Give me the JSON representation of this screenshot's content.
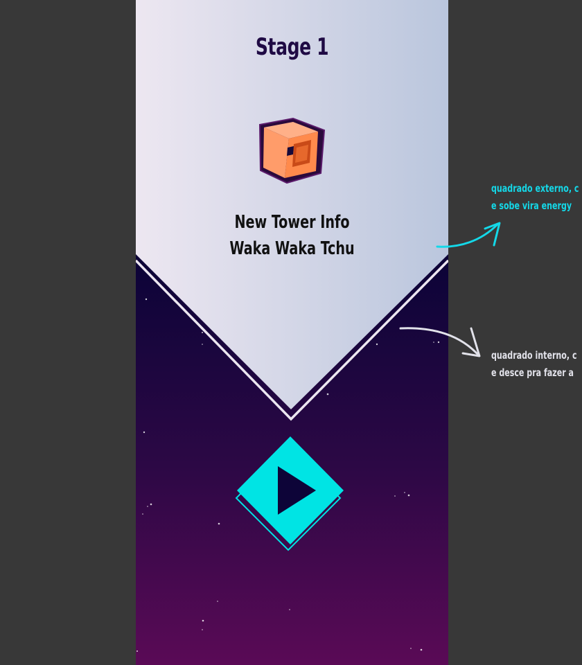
{
  "stage": {
    "title": "Stage 1",
    "info_heading": "New Tower Info",
    "info_name": "Waka Waka Tchu",
    "tower_icon": "orange-cube-tower-icon",
    "play_icon": "play-icon"
  },
  "annotations": {
    "outer": {
      "line1": "quadrado externo, c",
      "line2": "e sobe vira energy"
    },
    "inner": {
      "line1": "quadrado interno, c",
      "line2": "e desce pra fazer a"
    }
  },
  "colors": {
    "background": "#383838",
    "panel_light_left": "#ece6f0",
    "panel_light_right": "#bac6dd",
    "night_top": "#03002e",
    "night_bottom": "#5a0a56",
    "accent_cyan": "#00e4e4",
    "title_color": "#1f0a44",
    "tower_orange": "#ff8a4c"
  }
}
